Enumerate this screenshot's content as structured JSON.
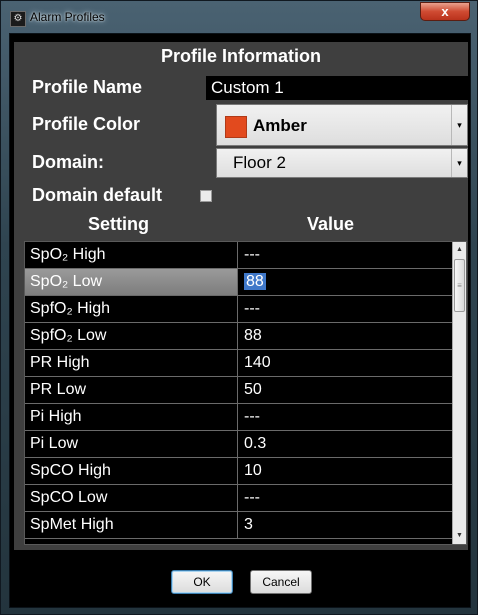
{
  "window": {
    "title": "Alarm Profiles",
    "close_symbol": "x",
    "app_icon_symbol": "⚙"
  },
  "header": {
    "title": "Profile Information"
  },
  "profile": {
    "name_label": "Profile Name",
    "name_value": "Custom 1",
    "color_label": "Profile Color",
    "color_value": "Amber",
    "color_hex": "#e24a1e",
    "domain_label": "Domain:",
    "domain_value": "Floor 2",
    "domain_default_label": "Domain default",
    "domain_default_checked": false
  },
  "table": {
    "columns": [
      "Setting",
      "Value"
    ],
    "rows": [
      {
        "setting": "SpO₂ High",
        "value": "---"
      },
      {
        "setting": "SpO₂ Low",
        "value": "88"
      },
      {
        "setting": "SpfO₂ High",
        "value": "---"
      },
      {
        "setting": "SpfO₂ Low",
        "value": "88"
      },
      {
        "setting": "PR High",
        "value": "140"
      },
      {
        "setting": "PR Low",
        "value": "50"
      },
      {
        "setting": "Pi High",
        "value": "---"
      },
      {
        "setting": "Pi Low",
        "value": "0.3"
      },
      {
        "setting": "SpCO High",
        "value": "10"
      },
      {
        "setting": "SpCO Low",
        "value": "---"
      },
      {
        "setting": "SpMet High",
        "value": "3"
      }
    ],
    "selected_row": 1
  },
  "buttons": {
    "ok_label": "OK",
    "cancel_label": "Cancel"
  },
  "icons": {
    "dropdown_arrow": "▾",
    "scroll_up": "▲",
    "scroll_down": "▼",
    "scroll_grip": "≡"
  }
}
